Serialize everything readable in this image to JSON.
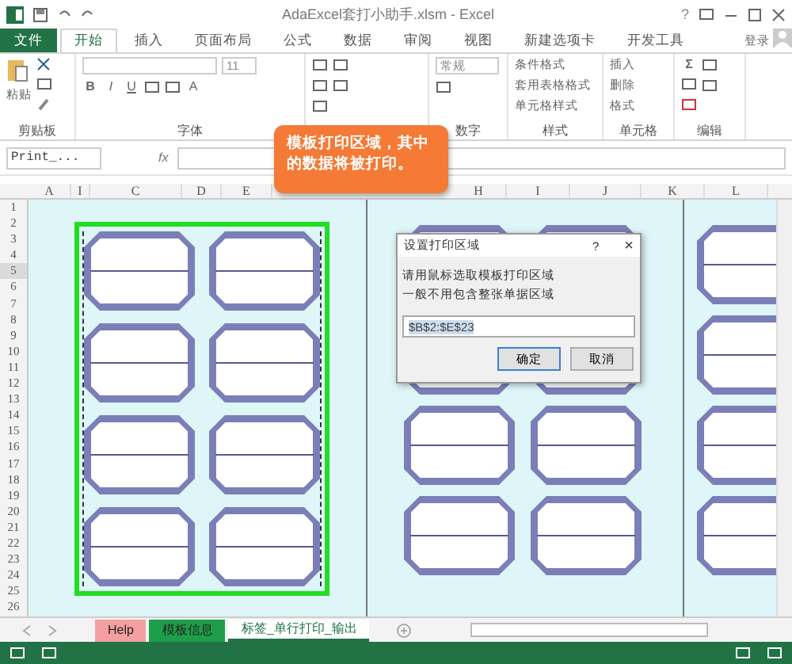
{
  "window": {
    "title": "AdaExcel套打小助手.xlsm - Excel",
    "controls": [
      "?"
    ]
  },
  "ribbon_tabs": [
    {
      "label": "文件",
      "kind": "file",
      "selected": false
    },
    {
      "label": "开始",
      "kind": "tab",
      "selected": true
    },
    {
      "label": "插入",
      "kind": "tab",
      "selected": false
    },
    {
      "label": "页面布局",
      "kind": "tab",
      "selected": false
    },
    {
      "label": "公式",
      "kind": "tab",
      "selected": false
    },
    {
      "label": "数据",
      "kind": "tab",
      "selected": false
    },
    {
      "label": "审阅",
      "kind": "tab",
      "selected": false
    },
    {
      "label": "视图",
      "kind": "tab",
      "selected": false
    },
    {
      "label": "新建选项卡",
      "kind": "tab",
      "selected": false
    },
    {
      "label": "开发工具",
      "kind": "tab",
      "selected": false
    }
  ],
  "sign_in": "登录",
  "ribbon": {
    "clipboard": {
      "paste": "粘贴",
      "label": "剪贴板"
    },
    "font": {
      "size": "11",
      "style_buttons": [
        "B",
        "I",
        "U"
      ],
      "color_button": "A",
      "label": "字体"
    },
    "number": {
      "format": "常规",
      "label": "数字"
    },
    "styles": {
      "items": [
        "条件格式",
        "套用表格格式",
        "单元格样式"
      ],
      "label": "样式"
    },
    "cells": {
      "items": [
        "插入",
        "删除",
        "格式"
      ],
      "label": "单元格"
    },
    "editing": {
      "sum": "Σ",
      "label": "编辑"
    }
  },
  "formula_bar": {
    "name_box": "Print_...",
    "fx": "fx"
  },
  "columns": [
    "A",
    "I",
    "C",
    "D",
    "E",
    "H",
    "I",
    "J",
    "K",
    "L"
  ],
  "rows": [
    {
      "label": "1",
      "selected": false
    },
    {
      "label": "2",
      "selected": false
    },
    {
      "label": "3",
      "selected": false
    },
    {
      "label": "4",
      "selected": false
    },
    {
      "label": "5",
      "selected": true
    },
    {
      "label": "6",
      "selected": false
    },
    {
      "label": "7",
      "selected": false
    },
    {
      "label": "8",
      "selected": false
    },
    {
      "label": "9",
      "selected": false
    },
    {
      "label": "10",
      "selected": false
    },
    {
      "label": "11",
      "selected": false
    },
    {
      "label": "12",
      "selected": false
    },
    {
      "label": "13",
      "selected": false
    },
    {
      "label": "14",
      "selected": false
    },
    {
      "label": "15",
      "selected": false
    },
    {
      "label": "16",
      "selected": false
    },
    {
      "label": "17",
      "selected": false
    },
    {
      "label": "18",
      "selected": false
    },
    {
      "label": "19",
      "selected": false
    },
    {
      "label": "20",
      "selected": false
    },
    {
      "label": "21",
      "selected": false
    },
    {
      "label": "22",
      "selected": false
    },
    {
      "label": "23",
      "selected": false
    },
    {
      "label": "24",
      "selected": false
    },
    {
      "label": "25",
      "selected": false
    },
    {
      "label": "26",
      "selected": false
    }
  ],
  "callout": {
    "text": "模板打印区域，其中的数据将被打印。"
  },
  "dialog": {
    "title": "设置打印区域",
    "help": "?",
    "close": "×",
    "lines": [
      "请用鼠标选取模板打印区域",
      "一般不用包含整张单据区域"
    ],
    "value": "$B$2:$E$23",
    "buttons": [
      {
        "label": "确定",
        "default": true
      },
      {
        "label": "取消",
        "default": false
      }
    ]
  },
  "sheet_tabs": [
    {
      "label": "Help",
      "color": "#f4a0a0",
      "selected": false
    },
    {
      "label": "模板信息",
      "color": "#1e9e4a",
      "selected": false
    },
    {
      "label": "标签_单行打印_输出",
      "color": "#ffffff",
      "selected": true
    }
  ]
}
